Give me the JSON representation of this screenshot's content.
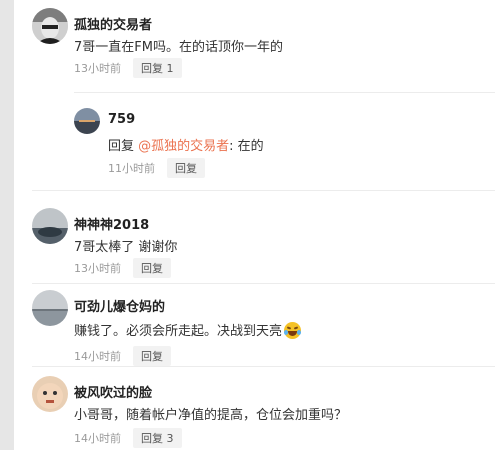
{
  "comments": [
    {
      "author": "孤独的交易者",
      "text": "7哥一直在FM吗。在的话顶你一年的",
      "time": "13小时前",
      "reply_label": "回复 1",
      "replies": [
        {
          "author": "759",
          "prefix": "回复 ",
          "mention": "@孤独的交易者",
          "text": ": 在的",
          "time": "11小时前",
          "reply_label": "回复"
        }
      ]
    },
    {
      "author": "神神神2018",
      "text": "7哥太棒了 谢谢你",
      "time": "13小时前",
      "reply_label": "回复"
    },
    {
      "author": "可劲儿爆仓妈的",
      "text": "赚钱了。必须会所走起。决战到天亮",
      "emoji": "laughing-crying-emoji",
      "time": "14小时前",
      "reply_label": "回复"
    },
    {
      "author": "被风吹过的脸",
      "text": "小哥哥，随着帐户净值的提高，仓位会加重吗？",
      "time": "14小时前",
      "reply_label": "回复 3"
    }
  ]
}
